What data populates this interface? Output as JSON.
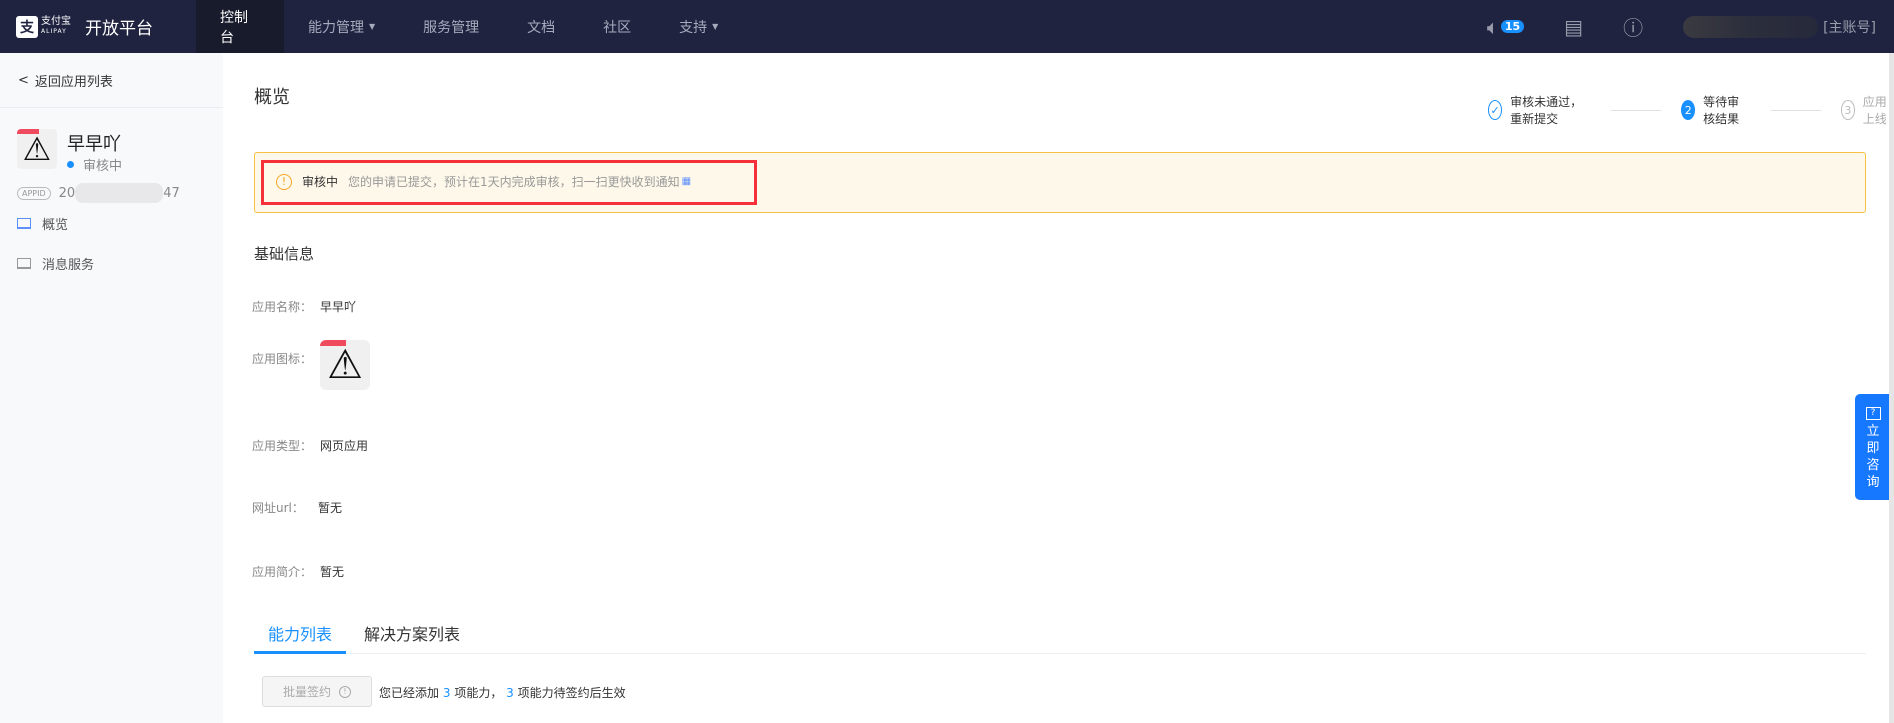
{
  "nav": {
    "logo_mark": "支",
    "logo_brand": "支付宝",
    "logo_sub": "ALIPAY",
    "platform": "开放平台",
    "items": [
      "控制台",
      "能力管理",
      "服务管理",
      "文档",
      "社区",
      "支持"
    ],
    "notification_count": "15",
    "account": "[主账号]"
  },
  "sidebar": {
    "back": "返回应用列表",
    "app_name": "早早吖",
    "status": "审核中",
    "appid_tag": "APPID",
    "appid_prefix": "20",
    "appid_suffix": "47",
    "items": [
      "概览",
      "消息服务"
    ]
  },
  "main": {
    "title": "概览",
    "steps": [
      {
        "icon": "✓",
        "label": "审核未通过，重新提交"
      },
      {
        "icon": "2",
        "label": "等待审核结果"
      },
      {
        "icon": "3",
        "label": "应用上线"
      }
    ],
    "alert": {
      "title": "审核中",
      "text": "您的申请已提交，预计在1天内完成审核，扫一扫更快收到通知",
      "qr": "▦"
    },
    "section": "基础信息",
    "fields": [
      {
        "label": "应用名称：",
        "value": "早早吖"
      },
      {
        "label": "应用图标："
      },
      {
        "label": "应用类型：",
        "value": "网页应用"
      },
      {
        "label": "网址url：",
        "value": "暂无"
      },
      {
        "label": "应用简介：",
        "value": "暂无"
      }
    ],
    "tabs": [
      "能力列表",
      "解决方案列表"
    ],
    "batch_button": "批量签约",
    "summary": {
      "p1": "您已经添加",
      "n1": "3",
      "p2": "项能力，",
      "n2": "3",
      "p3": "项能力待签约后生效"
    },
    "consult": [
      "立",
      "即",
      "咨",
      "询"
    ]
  }
}
